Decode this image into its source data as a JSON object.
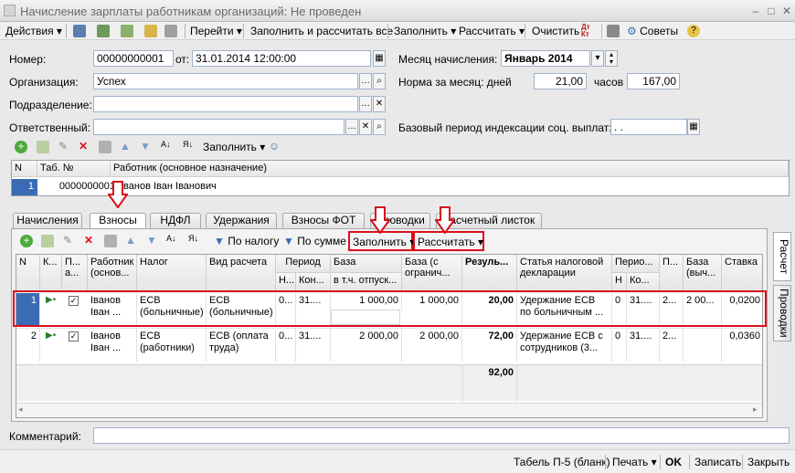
{
  "window": {
    "title": "Начисление зарплаты работникам организаций: Не проведен"
  },
  "toolbar": {
    "actions": "Действия",
    "goto": "Перейти",
    "fill_calc": "Заполнить и рассчитать все",
    "fill": "Заполнить",
    "calc": "Рассчитать",
    "clear": "Очистить",
    "advice": "Советы",
    "dtkt": "Дт Кт"
  },
  "form": {
    "number_label": "Номер:",
    "number": "00000000001",
    "from_label": "от:",
    "date": "31.01.2014 12:00:00",
    "org_label": "Организация:",
    "org": "Успех",
    "dept_label": "Подразделение:",
    "dept": "",
    "resp_label": "Ответственный:",
    "resp": "",
    "month_label": "Месяц начисления:",
    "month": "Январь 2014",
    "norm_label": "Норма за месяц: дней",
    "days": "21,00",
    "hours_label": "часов",
    "hours": "167,00",
    "base_label": "Базовый период индексации соц. выплат:",
    "base": " .  ."
  },
  "emp_toolbar": {
    "fill": "Заполнить"
  },
  "emp_table": {
    "h_n": "N",
    "h_tab": "Таб. №",
    "h_worker": "Работник (основное назначение)",
    "n": "1",
    "tab": "0000000001",
    "worker": "Іванов Іван Іванович"
  },
  "tabs": [
    "Начисления",
    "Взносы",
    "НДФЛ",
    "Удержания",
    "Взносы ФОТ",
    "Проводки",
    "Расчетный листок"
  ],
  "inner_toolbar": {
    "by_tax": "По налогу",
    "by_sum": "По сумме",
    "fill": "Заполнить",
    "calc": "Рассчитать"
  },
  "grid": {
    "headers": {
      "n": "N",
      "k": "К...",
      "p": "П... а...",
      "worker": "Работник (основ...",
      "tax": "Налог",
      "calc_kind": "Вид расчета",
      "period": "Период",
      "period_n": "Н...",
      "period_k": "Кон...",
      "base": "База",
      "base_sub": "в т.ч. отпуск...",
      "base_lim": "База (с огранич...",
      "result": "Резуль...",
      "article": "Статья налоговой декларации",
      "period2": "Перио...",
      "period2_n": "Н",
      "period2_k": "Ко...",
      "p2": "П...",
      "base2": "База (выч...",
      "rate": "Ставка"
    },
    "rows": [
      {
        "n": "1",
        "worker": "Іванов Іван ...",
        "tax": "ЕСВ (больничные)",
        "calc_kind": "ЕСВ (больничные)",
        "pn": "0...",
        "pk": "31....",
        "base": "1 000,00",
        "base_lim": "1 000,00",
        "result": "20,00",
        "article": "Удержание ЕСВ по больничным ...",
        "p2n": "0",
        "p2k": "31....",
        "p2": "2...",
        "base2": "2 00...",
        "rate": "0,0200"
      },
      {
        "n": "2",
        "worker": "Іванов Іван ...",
        "tax": "ЕСВ (работники)",
        "calc_kind": "ЕСВ (оплата труда)",
        "pn": "0...",
        "pk": "31....",
        "base": "2 000,00",
        "base_lim": "2 000,00",
        "result": "72,00",
        "article": "Удержание ЕСВ с сотрудников (3...",
        "p2n": "0",
        "p2k": "31....",
        "p2": "2...",
        "base2": "",
        "rate": "0,0360"
      }
    ],
    "total": "92,00"
  },
  "side_tabs": {
    "calc": "Расчет",
    "posting": "Проводки"
  },
  "comment_label": "Комментарий:",
  "bottom": {
    "form": "Табель П-5 (бланк)",
    "print": "Печать",
    "ok": "OK",
    "save": "Записать",
    "close": "Закрыть"
  },
  "colors": {
    "highlight": "#d9101c",
    "accent_blue": "#3a6cb5"
  }
}
